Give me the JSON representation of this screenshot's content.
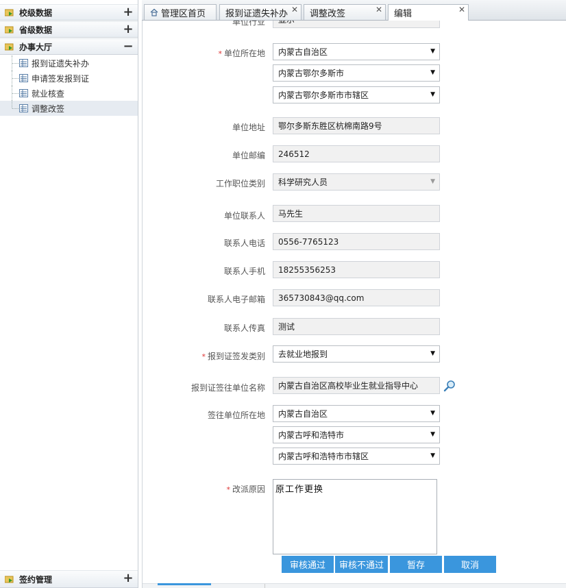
{
  "sidebar": {
    "sections": [
      {
        "title": "校级数据",
        "toggle": "+"
      },
      {
        "title": "省级数据",
        "toggle": "+"
      },
      {
        "title": "办事大厅",
        "toggle": "−"
      },
      {
        "title": "签约管理",
        "toggle": "+"
      }
    ],
    "items": [
      {
        "label": "报到证遗失补办"
      },
      {
        "label": "申请签发报到证"
      },
      {
        "label": "就业核查"
      },
      {
        "label": "调整改签"
      }
    ]
  },
  "tabs": [
    {
      "label": "管理区首页",
      "icon": "home-icon"
    },
    {
      "label": "报到证遗失补办"
    },
    {
      "label": "调整改签"
    },
    {
      "label": "编辑"
    }
  ],
  "form": {
    "partial_field": "显示",
    "unit_location": {
      "label": "单位所在地",
      "province": "内蒙古自治区",
      "city": "内蒙古鄂尔多斯市",
      "district": "内蒙古鄂尔多斯市市辖区"
    },
    "unit_address": {
      "label": "单位地址",
      "value": "鄂尔多斯东胜区杭棉南路9号"
    },
    "unit_postcode": {
      "label": "单位邮编",
      "value": "246512"
    },
    "job_category": {
      "label": "工作职位类别",
      "value": "科学研究人员"
    },
    "contact_person": {
      "label": "单位联系人",
      "value": "马先生"
    },
    "contact_phone": {
      "label": "联系人电话",
      "value": "0556-7765123"
    },
    "contact_mobile": {
      "label": "联系人手机",
      "value": "18255356253"
    },
    "contact_email": {
      "label": "联系人电子邮箱",
      "value": "365730843@qq.com"
    },
    "contact_fax": {
      "label": "联系人传真",
      "value": "测试"
    },
    "cert_issue_type": {
      "label": "报到证签发类别",
      "value": "去就业地报到"
    },
    "cert_dest_unit": {
      "label": "报到证签往单位名称",
      "value": "内蒙古自治区高校毕业生就业指导中心"
    },
    "dest_location": {
      "label": "签往单位所在地",
      "province": "内蒙古自治区",
      "city": "内蒙古呼和浩特市",
      "district": "内蒙古呼和浩特市市辖区"
    },
    "reason": {
      "label": "改派原因",
      "value": "原工作更换"
    }
  },
  "buttons": {
    "approve": "审核通过",
    "reject": "审核不通过",
    "save_draft": "暂存",
    "cancel": "取消"
  },
  "required_mark": "*",
  "colors": {
    "accent": "#3a96dd",
    "required": "#dd3333"
  }
}
